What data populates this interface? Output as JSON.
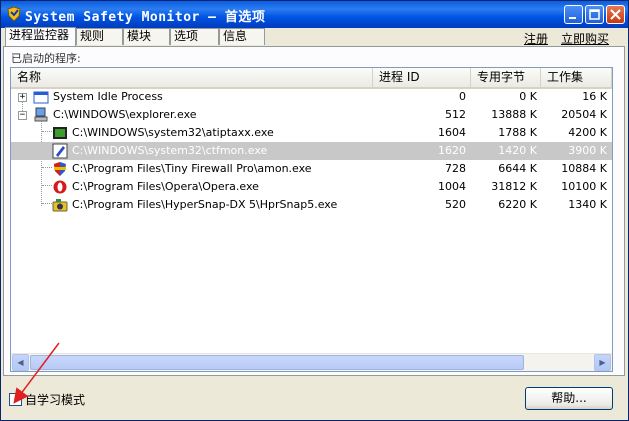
{
  "window": {
    "title": "System Safety Monitor — 首选项"
  },
  "tabs": [
    {
      "label": "进程监控器",
      "active": true
    },
    {
      "label": "规则",
      "active": false
    },
    {
      "label": "模块",
      "active": false
    },
    {
      "label": "选项",
      "active": false
    },
    {
      "label": "信息",
      "active": false
    }
  ],
  "links": {
    "register": "注册",
    "buy_now": "立即购买"
  },
  "group": {
    "label": "已启动的程序:"
  },
  "table": {
    "headers": {
      "name": "名称",
      "pid": "进程 ID",
      "private_bytes": "专用字节",
      "working_set": "工作集"
    },
    "rows": [
      {
        "name": "System Idle Process",
        "pid": "0",
        "private_bytes": "0 K",
        "working_set": "16 K",
        "icon": "system-window-icon"
      },
      {
        "name": "C:\\WINDOWS\\explorer.exe",
        "pid": "512",
        "private_bytes": "13888 K",
        "working_set": "20504 K",
        "icon": "computer-icon"
      },
      {
        "name": "C:\\WINDOWS\\system32\\atiptaxx.exe",
        "pid": "1604",
        "private_bytes": "1788 K",
        "working_set": "4200 K",
        "icon": "ati-icon"
      },
      {
        "name": "C:\\WINDOWS\\system32\\ctfmon.exe",
        "pid": "1620",
        "private_bytes": "1420 K",
        "working_set": "3900 K",
        "icon": "pen-icon",
        "selected": true
      },
      {
        "name": "C:\\Program Files\\Tiny Firewall Pro\\amon.exe",
        "pid": "728",
        "private_bytes": "6644 K",
        "working_set": "10884 K",
        "icon": "shield-icon"
      },
      {
        "name": "C:\\Program Files\\Opera\\Opera.exe",
        "pid": "1004",
        "private_bytes": "31812 K",
        "working_set": "10100 K",
        "icon": "opera-icon"
      },
      {
        "name": "C:\\Program Files\\HyperSnap-DX 5\\HprSnap5.exe",
        "pid": "520",
        "private_bytes": "6220 K",
        "working_set": "1340 K",
        "icon": "camera-icon"
      }
    ]
  },
  "self_learning": {
    "label": "自学习模式",
    "checked": false
  },
  "buttons": {
    "help": "帮助..."
  },
  "colors": {
    "titlebar": "#0054e3",
    "selection": "#c8c8c8",
    "annotation_arrow": "#e02020"
  }
}
